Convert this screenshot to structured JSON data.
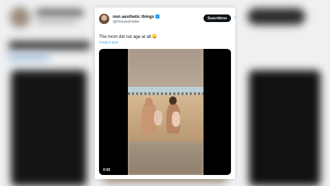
{
  "tweet": {
    "author_name": "non aesthetic things",
    "handle": "@PicturesFolder",
    "subscribe_label": "Suscribirse",
    "more_label": "···",
    "text": "The mom did not age at all",
    "emoji": "smiling-face-with-sweat-icon",
    "translate_label": "Traducir post",
    "verified_icon": "verified-badge-icon"
  },
  "video": {
    "timestamp": "0:02"
  },
  "colors": {
    "subscribe_bg": "#0f1419",
    "link": "#1d9bf0",
    "verified": "#1d9bf0"
  }
}
